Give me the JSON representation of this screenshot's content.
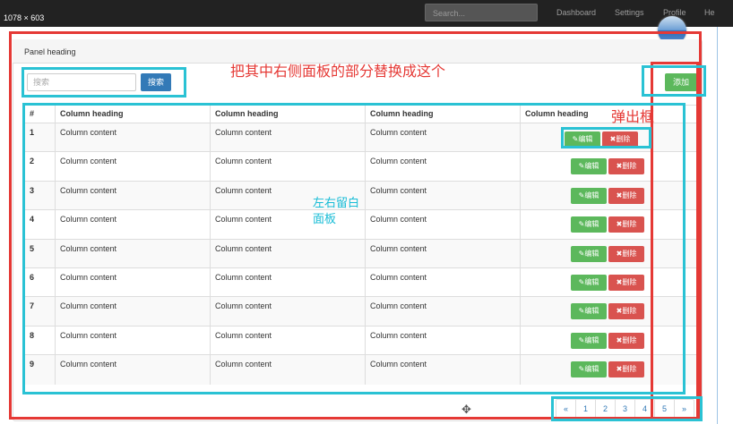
{
  "topbar": {
    "dimensions": "1078 × 603",
    "search_placeholder": "Search...",
    "nav": [
      "Dashboard",
      "Settings",
      "Profile",
      "He"
    ]
  },
  "panel": {
    "heading": "Panel heading",
    "search_placeholder": "搜索",
    "search_button": "搜索",
    "add_button": "添加"
  },
  "table": {
    "headers": [
      "#",
      "Column heading",
      "Column heading",
      "Column heading",
      "Column heading"
    ],
    "rows": [
      {
        "num": "1",
        "c1": "Column content",
        "c2": "Column content",
        "c3": "Column content"
      },
      {
        "num": "2",
        "c1": "Column content",
        "c2": "Column content",
        "c3": "Column content"
      },
      {
        "num": "3",
        "c1": "Column content",
        "c2": "Column content",
        "c3": "Column content"
      },
      {
        "num": "4",
        "c1": "Column content",
        "c2": "Column content",
        "c3": "Column content"
      },
      {
        "num": "5",
        "c1": "Column content",
        "c2": "Column content",
        "c3": "Column content"
      },
      {
        "num": "6",
        "c1": "Column content",
        "c2": "Column content",
        "c3": "Column content"
      },
      {
        "num": "7",
        "c1": "Column content",
        "c2": "Column content",
        "c3": "Column content"
      },
      {
        "num": "8",
        "c1": "Column content",
        "c2": "Column content",
        "c3": "Column content"
      },
      {
        "num": "9",
        "c1": "Column content",
        "c2": "Column content",
        "c3": "Column content"
      }
    ],
    "edit_label": "✎编辑",
    "delete_label": "✖删除"
  },
  "pagination": [
    "«",
    "1",
    "2",
    "3",
    "4",
    "5",
    "»"
  ],
  "annotations": {
    "replace_note": "把其中右侧面板的部分替换成这个",
    "popup_note": "弹出框",
    "margin_note": [
      "左右留白",
      "面板"
    ]
  },
  "colors": {
    "red": "#e53935",
    "cyan": "#2ac2d4",
    "success": "#5cb85c",
    "danger": "#d9534f",
    "primary": "#337ab7"
  },
  "icons": {
    "move": "move-cursor-icon",
    "edit": "pencil-icon",
    "delete": "x-icon"
  }
}
